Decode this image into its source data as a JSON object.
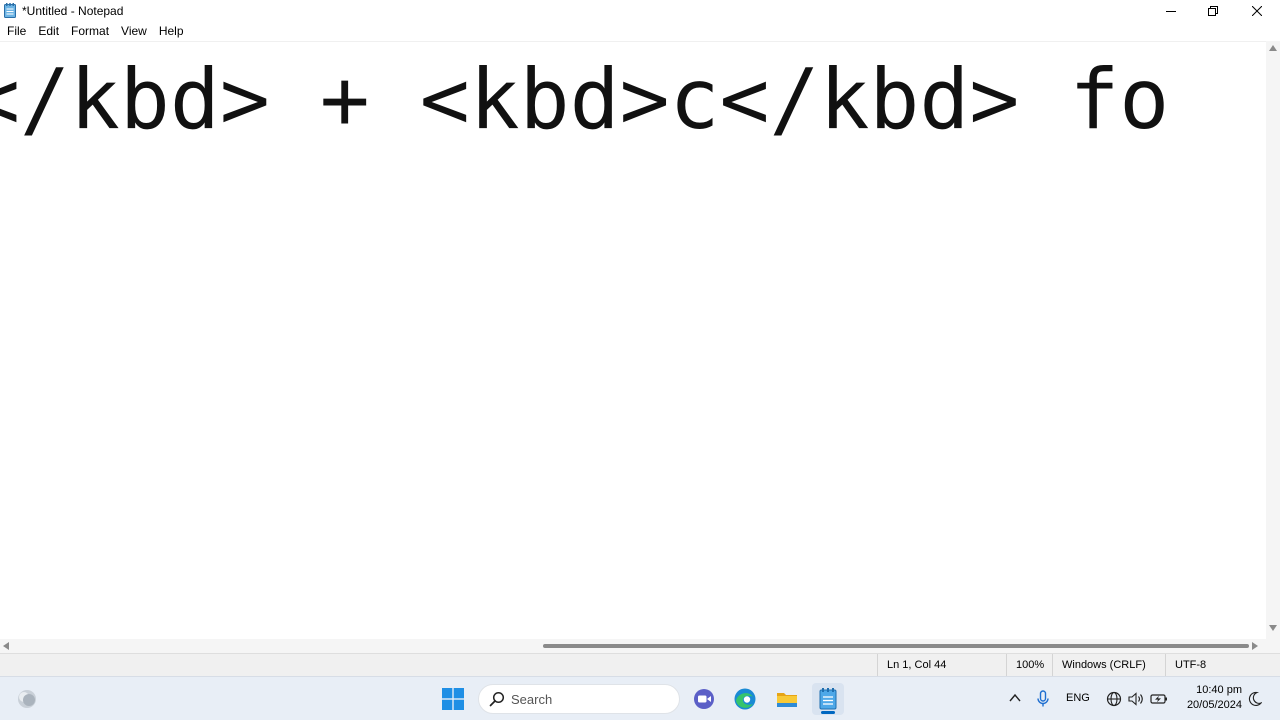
{
  "window": {
    "title": "*Untitled - Notepad",
    "icon": "notepad-icon"
  },
  "menu": {
    "items": [
      "File",
      "Edit",
      "Format",
      "View",
      "Help"
    ]
  },
  "editor": {
    "visible_text": "r</kbd> + <kbd>c</kbd> fo"
  },
  "statusbar": {
    "position": "Ln 1, Col 44",
    "zoom": "100%",
    "line_ending": "Windows (CRLF)",
    "encoding": "UTF-8"
  },
  "taskbar": {
    "search_label": "Search",
    "pinned_apps": [
      "meet-icon",
      "edge-icon",
      "file-explorer-icon",
      "notepad-icon"
    ],
    "tray": {
      "language": "ENG",
      "time": "10:40 pm",
      "date": "20/05/2024"
    }
  },
  "colors": {
    "accent": "#0067c0",
    "taskbar_bg": "#e8eef6",
    "statusbar_bg": "#f0f0f0"
  }
}
